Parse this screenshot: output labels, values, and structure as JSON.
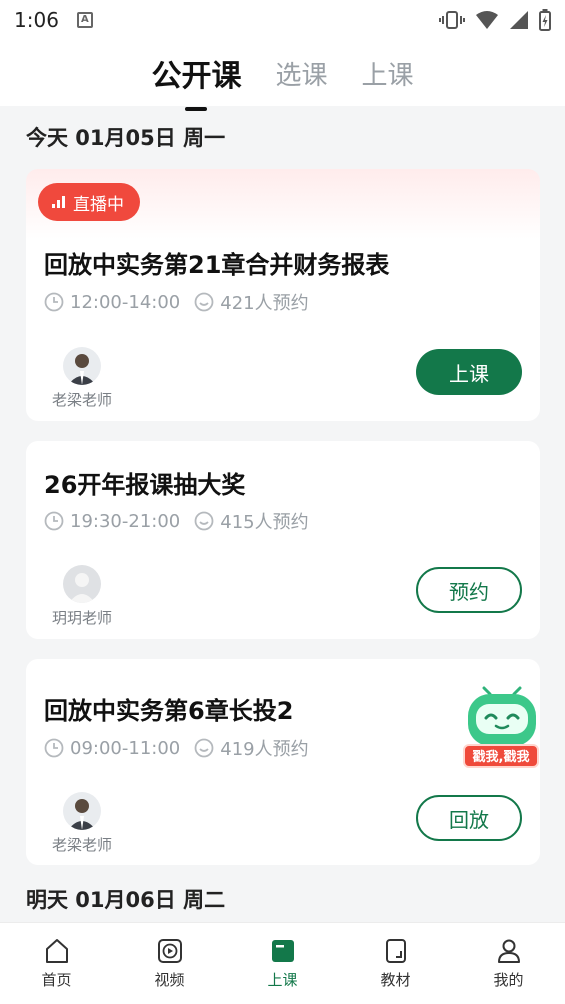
{
  "status_bar": {
    "time": "1:06",
    "a_badge": "A"
  },
  "top_tabs": [
    {
      "label": "公开课",
      "active": true
    },
    {
      "label": "选课",
      "active": false
    },
    {
      "label": "上课",
      "active": false
    }
  ],
  "sections": [
    {
      "date": "今天 01月05日 周一"
    },
    {
      "date": "明天 01月06日 周二"
    }
  ],
  "courses": [
    {
      "badge": "直播中",
      "title": "回放中实务第21章合并财务报表",
      "time": "12:00-14:00",
      "reservations": "421人预约",
      "teacher": "老梁老师",
      "action": "上课",
      "action_style": "solid"
    },
    {
      "title": "26开年报课抽大奖",
      "time": "19:30-21:00",
      "reservations": "415人预约",
      "teacher": "玥玥老师",
      "action": "预约",
      "action_style": "outline"
    },
    {
      "title": "回放中实务第6章长投2",
      "time": "09:00-11:00",
      "reservations": "419人预约",
      "teacher": "老梁老师",
      "action": "回放",
      "action_style": "outline"
    }
  ],
  "mascot": {
    "label": "戳我,戳我"
  },
  "bottom_nav": [
    {
      "label": "首页",
      "icon": "home-icon",
      "active": false
    },
    {
      "label": "视频",
      "icon": "video-icon",
      "active": false
    },
    {
      "label": "上课",
      "icon": "class-icon",
      "active": true
    },
    {
      "label": "教材",
      "icon": "book-icon",
      "active": false
    },
    {
      "label": "我的",
      "icon": "profile-icon",
      "active": false
    }
  ],
  "colors": {
    "brand_green": "#13784a",
    "live_red": "#f0493d",
    "background": "#f4f5f6"
  }
}
